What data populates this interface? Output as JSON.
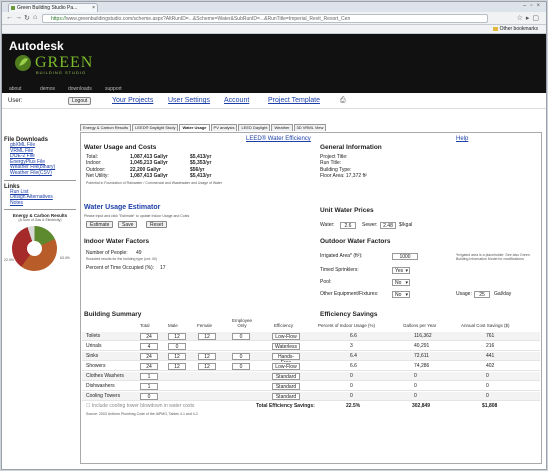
{
  "browser": {
    "tab_title": "Green Building Studio Pa...",
    "url_host": "https://",
    "url_rest": "www.greenbuildingstudio.com/scheme.aspx?AltRunID=...&Scheme=Water&SubRunID=...&RunTitle=Imperial_Revit_Resort_Cen",
    "bookmark": "Other bookmarks"
  },
  "header": {
    "brand": "Autodesk",
    "product": "GREEN",
    "product_sub": "BUILDING STUDIO",
    "nav": [
      "about",
      "demos",
      "downloads",
      "support"
    ]
  },
  "userbar": {
    "label": "User:",
    "logout": "Logout",
    "links": [
      "Your Projects",
      "User Settings",
      "Account",
      "Project Template"
    ]
  },
  "tabs": [
    "Energy & Carbon Results",
    "LEED® Daylight Study",
    "Water Usage",
    "PV analysis",
    "LEED Daylight",
    "Weather",
    "3D VRML View"
  ],
  "sidebar": {
    "downloads_title": "File Downloads",
    "downloads": [
      "gbXML File",
      "VRML File",
      "DOE-2 File",
      "EnergyPlus File",
      "Weather File(binary)",
      "Weather File(CSV)"
    ],
    "links_title": "Links",
    "links": [
      "Run List",
      "Design Alternatives",
      "Notes"
    ],
    "chart_title": "Energy & Carbon Results",
    "chart_sub": "(A Sum of Gas & Electricity)",
    "pie_left": "22.0%",
    "pie_right": "63.4%"
  },
  "main": {
    "leed_link": "LEED® Water Efficiency",
    "help": "Help",
    "usage": {
      "title": "Water Usage and Costs",
      "rows": [
        [
          "Total:",
          "1,087,413 Gal/yr",
          "$5,413/yr"
        ],
        [
          "Indoor:",
          "1,045,213 Gal/yr",
          "$5,353/yr"
        ],
        [
          "Outdoor:",
          "22,200 Gal/yr",
          "$56/yr"
        ],
        [
          "Net Utility:",
          "1,087,413 Gal/yr",
          "$5,413/yr"
        ]
      ],
      "note": "Potential in Foundation of Rainwater / Commercial and Wastewater and Usage of Water"
    },
    "general": {
      "title": "General Information",
      "rows": [
        "Project Title:",
        "Run Title:",
        "Building Type:",
        "Floor Area: 17,372 ft²"
      ]
    },
    "estimator": {
      "title": "Water Usage Estimator",
      "note": "Please input and click \"Estimate\" to update Indoor Usage and Costs",
      "buttons": [
        "Estimate",
        "Save",
        "Reset"
      ]
    },
    "prices": {
      "title": "Unit Water Prices",
      "water_label": "Water:",
      "water": "2.6",
      "sewer_label": "Sewer:",
      "sewer": "2.48",
      "unit": "$/kgal"
    },
    "indoor": {
      "title": "Indoor Water Factors",
      "people_label": "Number of People:",
      "people": "49",
      "people_note": "Rounded results for the building type (cnt: 40)",
      "absent_label": "Percent of Time Occupied (%):",
      "absent": "17"
    },
    "outdoor": {
      "title": "Outdoor Water Factors",
      "irrigated_label": "Irrigated Area* (ft²):",
      "irrigated": "1000",
      "timed_label": "Timed Sprinklers:",
      "timed": "Yes",
      "pool_label": "Pool:",
      "pool": "No",
      "other_label": "Other Equipment/Fixtures:",
      "other": "No",
      "usage_label": "Usage:",
      "usage": "25",
      "usage_unit": "Gal/day",
      "note": "*Irrigated area is a placeholder. See also Green Building Information Model for modifications"
    },
    "summary": {
      "title": "Building Summary",
      "headers": [
        "Total",
        "Male",
        "Female",
        "Employee Only",
        "Efficiency"
      ],
      "rows": [
        [
          "Toilets",
          "24",
          "12",
          "12",
          "0",
          "Low-Flow"
        ],
        [
          "Urinals",
          "4",
          "0",
          "",
          "",
          "Waterless"
        ],
        [
          "Sinks",
          "24",
          "12",
          "12",
          "0",
          "Hands-Free"
        ],
        [
          "Showers",
          "24",
          "12",
          "12",
          "0",
          "Low-Flow"
        ],
        [
          "Clothes Washers",
          "1",
          "",
          "",
          "",
          "Standard"
        ],
        [
          "Dishwashers",
          "1",
          "",
          "",
          "",
          "Standard"
        ],
        [
          "Cooling Towers",
          "0",
          "",
          "",
          "",
          "Standard"
        ]
      ],
      "check": "Include cooling tower blowdown in water costs",
      "source": "Source: 2003 Uniform Plumbing Code of the IAPMO, Tables 4-1 and 4-2"
    },
    "savings": {
      "title": "Efficiency Savings",
      "headers": [
        "Percent of Indoor Usage (%)",
        "Gallons per Year",
        "Annual Cost Savings ($)"
      ],
      "rows": [
        [
          "6.6",
          "116,362",
          "761"
        ],
        [
          "3",
          "40,291",
          "216"
        ],
        [
          "6.4",
          "72,611",
          "441"
        ],
        [
          "6.6",
          "74,286",
          "402"
        ],
        [
          "0",
          "0",
          "0"
        ],
        [
          "0",
          "0",
          "0"
        ],
        [
          "0",
          "0",
          "0"
        ]
      ],
      "total_label": "Total Efficiency Savings:",
      "total": [
        "22.5%",
        "302,849",
        "$1,808"
      ]
    }
  }
}
